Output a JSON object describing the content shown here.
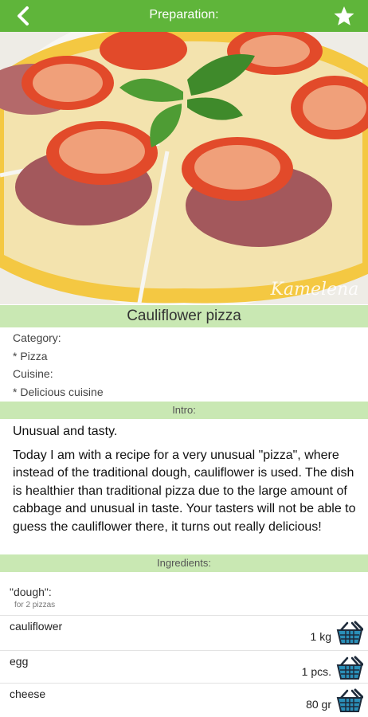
{
  "header": {
    "title": "Preparation:"
  },
  "photo": {
    "watermark": "Kamelena"
  },
  "recipe": {
    "title": "Cauliflower pizza",
    "category_label": "Category:",
    "category_value": "* Pizza",
    "cuisine_label": "Cuisine:",
    "cuisine_value": "* Delicious cuisine"
  },
  "intro": {
    "heading": "Intro:",
    "paragraphs": [
      "Unusual and tasty.",
      "Today I am with a recipe for a very unusual \"pizza\", where instead of the traditional dough, cauliflower is used. The dish is healthier than traditional pizza due to the large amount of cabbage and unusual in taste. Your tasters will not be able to guess the cauliflower there, it turns out really delicious!"
    ]
  },
  "ingredients": {
    "heading": "Ingredients:",
    "group_name": "\"dough\":",
    "group_note": "for 2 pizzas",
    "items": [
      {
        "name": "cauliflower",
        "qty": "1 kg"
      },
      {
        "name": "egg",
        "qty": "1 pcs."
      },
      {
        "name": "cheese",
        "qty": "80 gr"
      }
    ]
  },
  "colors": {
    "accent": "#5fb53a",
    "section_bg": "#c9e8b3"
  },
  "icons": [
    "back-arrow-icon",
    "star-icon",
    "basket-icon"
  ]
}
